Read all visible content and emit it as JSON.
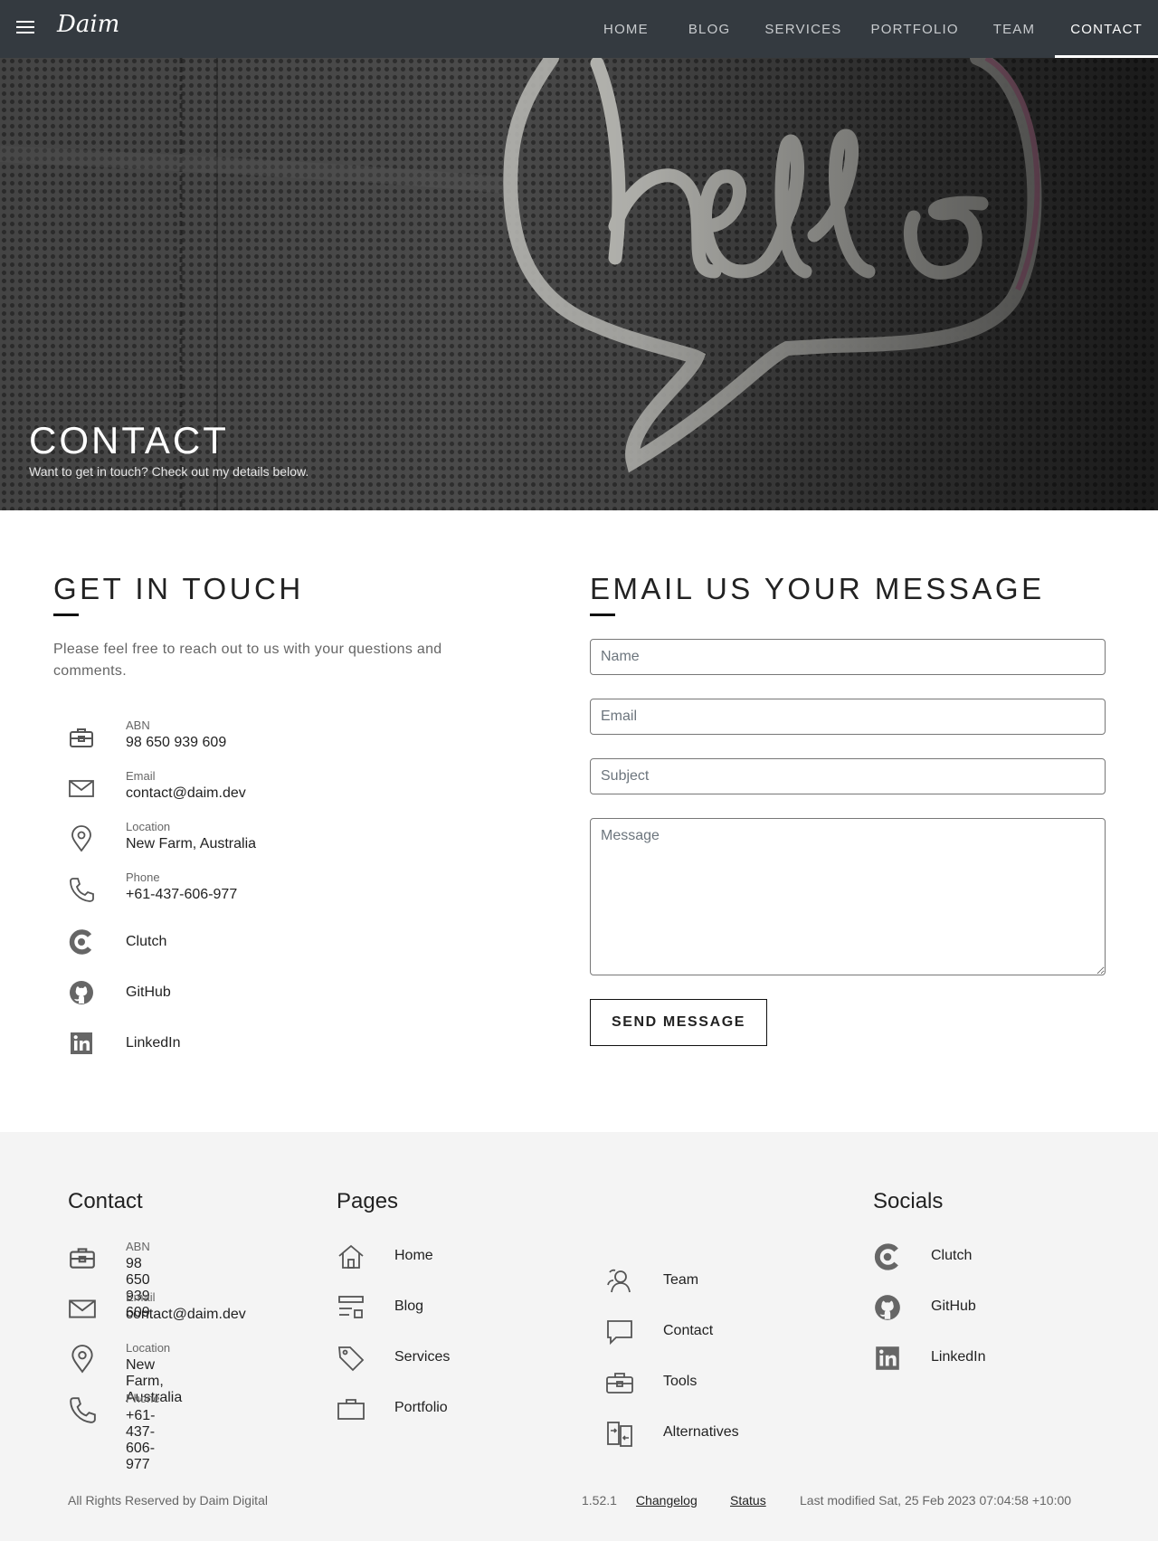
{
  "nav": {
    "logo": "Daim",
    "links": [
      "HOME",
      "BLOG",
      "SERVICES",
      "PORTFOLIO",
      "TEAM",
      "CONTACT"
    ],
    "active": "CONTACT"
  },
  "hero": {
    "title": "CONTACT",
    "subtitle": "Want to get in touch? Check out my details below."
  },
  "touch": {
    "heading": "GET IN TOUCH",
    "intro": "Please feel free to reach out to us with your questions and comments.",
    "abn_label": "ABN",
    "abn_value": "98 650 939 609",
    "email_label": "Email",
    "email_value": "contact@daim.dev",
    "location_label": "Location",
    "location_value": "New Farm, Australia",
    "phone_label": "Phone",
    "phone_value": "+61-437-606-977",
    "clutch": "Clutch",
    "github": "GitHub",
    "linkedin": "LinkedIn"
  },
  "form": {
    "heading": "EMAIL US YOUR MESSAGE",
    "name_placeholder": "Name",
    "email_placeholder": "Email",
    "subject_placeholder": "Subject",
    "message_placeholder": "Message",
    "send_label": "SEND MESSAGE"
  },
  "footer": {
    "contact_heading": "Contact",
    "pages_heading": "Pages",
    "socials_heading": "Socials",
    "abn_label": "ABN",
    "abn_value": "98 650 939 609",
    "email_label": "Email",
    "email_value": "contact@daim.dev",
    "location_label": "Location",
    "location_value": "New Farm, Australia",
    "phone_label": "Phone",
    "phone_value": "+61-437-606-977",
    "pages": [
      "Home",
      "Blog",
      "Services",
      "Portfolio",
      "Team",
      "Contact",
      "Tools",
      "Alternatives"
    ],
    "socials": [
      "Clutch",
      "GitHub",
      "LinkedIn"
    ],
    "rights": "All Rights Reserved by Daim Digital",
    "version": "1.52.1",
    "changelog": "Changelog",
    "status": "Status",
    "last_modified": "Last modified Sat, 25 Feb 2023 07:04:58 +10:00"
  }
}
